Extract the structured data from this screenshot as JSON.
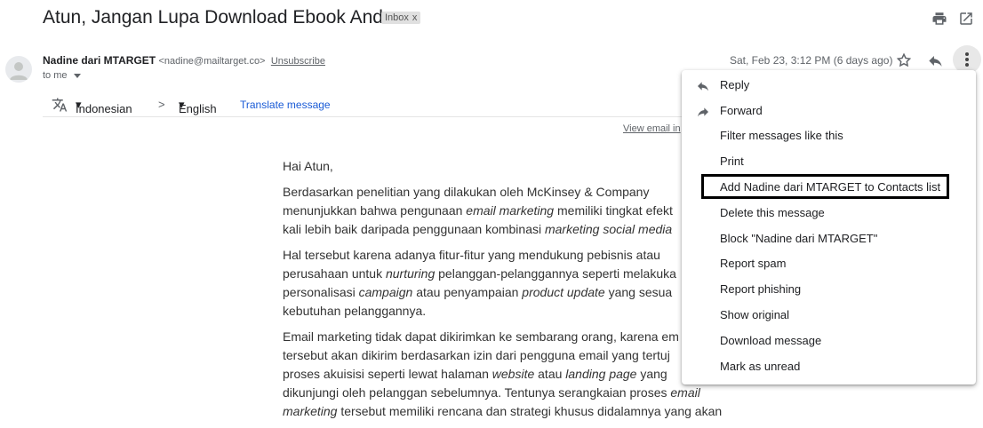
{
  "subject": "Atun, Jangan Lupa Download Ebook Anda",
  "label": "Inbox",
  "label_remove": "x",
  "sender": {
    "name": "Nadine dari MTARGET",
    "email": "<nadine@mailtarget.co>",
    "unsubscribe": "Unsubscribe",
    "to": "to me"
  },
  "date": "Sat, Feb 23, 3:12 PM (6 days ago)",
  "translate": {
    "from": "Indonesian",
    "to": "English",
    "link": "Translate message",
    "separator": ">"
  },
  "view_in_browser": "View email in",
  "body": {
    "greeting": "Hai Atun,",
    "p1": [
      [
        "Berdasarkan penelitian yang dilakukan oleh McKinsey & Company",
        ""
      ],
      [
        "menunjukkan bahwa pengunaan ",
        "email marketing",
        " memiliki tingkat efekt"
      ],
      [
        "kali lebih baik daripada penggunaan kombinasi ",
        "marketing social media",
        ""
      ]
    ],
    "p2": [
      [
        "Hal tersebut karena adanya fitur-fitur yang mendukung pebisnis atau"
      ],
      [
        "perusahaan untuk ",
        "nurturing",
        " pelanggan-pelanggannya seperti melakuka"
      ],
      [
        "personalisasi ",
        "campaign",
        " atau penyampaian ",
        "product update",
        " yang sesua"
      ],
      [
        "kebutuhan pelanggannya."
      ]
    ],
    "p3": [
      [
        "Email marketing tidak dapat dikirimkan ke sembarang orang, karena em"
      ],
      [
        "tersebut akan dikirim berdasarkan izin dari pengguna email yang tertuj"
      ],
      [
        "proses akuisisi seperti lewat halaman ",
        "website",
        " atau ",
        "landing page",
        " yang"
      ],
      [
        "dikunjungi oleh pelanggan sebelumnya. Tentunya serangkaian proses ",
        "email"
      ],
      [
        "marketing",
        " tersebut memiliki rencana dan strategi khusus didalamnya yang akan"
      ]
    ]
  },
  "menu": {
    "items": [
      {
        "label": "Reply",
        "icon": "reply-icon"
      },
      {
        "label": "Forward",
        "icon": "forward-icon"
      },
      {
        "label": "Filter messages like this"
      },
      {
        "label": "Print"
      },
      {
        "label": "Add Nadine dari MTARGET to Contacts list",
        "highlighted": true
      },
      {
        "label": "Delete this message"
      },
      {
        "label": "Block \"Nadine dari MTARGET\""
      },
      {
        "label": "Report spam"
      },
      {
        "label": "Report phishing"
      },
      {
        "label": "Show original"
      },
      {
        "label": "Download message"
      },
      {
        "label": "Mark as unread"
      }
    ]
  },
  "colors": {
    "link": "#1a5bd6",
    "icon": "#5f6368",
    "highlight_border": "#000000"
  }
}
